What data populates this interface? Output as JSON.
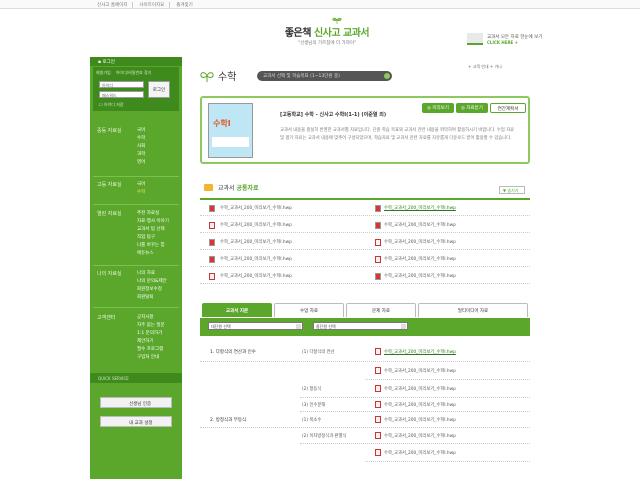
{
  "topbar": {
    "links": [
      "신사고 홈페이지",
      "사이트이지요",
      "즐겨찾기"
    ]
  },
  "logo": {
    "main_left": "좋은책",
    "main_mid": "신사고",
    "main_right": "교과서",
    "slogan": "\"선생님의 가르침에 더 가까이\""
  },
  "promo": {
    "line1": "교과서 모든 자료 한눈에 보기",
    "line2": "CLICK HERE +"
  },
  "login": {
    "header": "로그인",
    "tab1": "회원가입",
    "tab2": "아이디/비밀번호 찾기",
    "id_value": "아이디",
    "pw_value": "패스워드",
    "button": "로그인",
    "save_id": "아이디 저장"
  },
  "nav": [
    {
      "heading": "중등 자료실",
      "items": [
        "국어",
        "수학",
        "사회",
        "과학",
        "영어"
      ],
      "active": -1
    },
    {
      "heading": "고등 자료실",
      "items": [
        "국어",
        "수학"
      ],
      "active": 1
    },
    {
      "heading": "열린 자료실",
      "items": [
        "추천 자료실",
        "자료·행사 이야기",
        "교과서 탐 선택",
        "직업 탐구",
        "나를 바꾸는 힘",
        "에듀뉴스"
      ],
      "active": -1
    },
    {
      "heading": "나의 자료실",
      "items": [
        "나의 자료",
        "나의 문의&제안",
        "회원정보수정",
        "회원탈퇴"
      ],
      "active": -1
    },
    {
      "heading": "고객센터",
      "items": [
        "공지사항",
        "자주 묻는 질문",
        "1:1 문의하기",
        "제안하기",
        "필수 프로그램",
        "구입처 안내"
      ],
      "active": -1
    }
  ],
  "quick_service": {
    "header": "QUICK SERVICE",
    "btn1": "선생님 인증",
    "btn2": "내 교과 설정"
  },
  "subject": {
    "title": "수학",
    "search_value": "교과서 선택 및 학습목표 (1~13단원 중)",
    "tools": "+ 고객 안내 + 가나"
  },
  "book": {
    "cover_title": "수학Ⅰ",
    "title": "[고등학교] 수학 - 신사고 수학Ⅰ(1-1) (이준열 외)",
    "desc": "교과서 내용을 충실히 반영한 교과서별 자료입니다. 단원 학습 목표와 교과서 관련 내용을 파악하여 활용하시기 바랍니다. 수업 자료 및 평가 자료는 교과서 내용에 맞추어 구성되었으며, 학습자료 및 교과서 관련 자료를 자유롭게 다운로드 받아 활용할 수 있습니다.",
    "btn_preview": "미리보기",
    "btn_download": "자료받기",
    "btn_plan": "연간계획서"
  },
  "common": {
    "title_left": "교과서",
    "title_right": "공통자료",
    "hide": "숨기기",
    "rows": [
      [
        "수학_교과서_200_미리보기_수학Ⅰ.hwp",
        "수학_교과서_200_미리보기_수학Ⅰ.hwp"
      ],
      [
        "수학_교과서_200_미리보기_수학Ⅰ.hwp",
        "수학_교과서_200_미리보기_수학Ⅰ.hwp"
      ],
      [
        "수학_교과서_200_미리보기_수학Ⅰ.hwp",
        "수학_교과서_200_미리보기_수학Ⅰ.hwp"
      ],
      [
        "수학_교과서_200_미리보기_수학Ⅰ.hwp",
        "수학_교과서_200_미리보기_수학Ⅰ.hwp"
      ],
      [
        "수학_교과서_200_미리보기_수학Ⅰ.hwp",
        "수학_교과서_200_미리보기_수학Ⅰ.hwp"
      ]
    ]
  },
  "tabs": [
    "교과서 지문",
    "수업 자료",
    "문제 자료",
    "멀티미디어 자료"
  ],
  "filters": {
    "unit": "대단원 선택",
    "sub": "중단원 선택"
  },
  "lessons": [
    {
      "unit": "1. 다항식의 연산과 인수",
      "sub": "(1) 다항식의 연산",
      "file": "수학_교과서_200_미리보기_수학Ⅰ.hwp"
    },
    {
      "unit": "",
      "sub": "",
      "file": "수학_교과서_200_미리보기_수학Ⅰ.hwp"
    },
    {
      "unit": "",
      "sub": "(2) 항등식",
      "file": "수학_교과서_200_미리보기_수학Ⅰ.hwp"
    },
    {
      "unit": "",
      "sub": "(3) 인수분해",
      "file": "수학_교과서_200_미리보기_수학Ⅰ.hwp"
    },
    {
      "unit": "2. 방정식과 부등식",
      "sub": "(1) 복소수",
      "file": "수학_교과서_200_미리보기_수학Ⅰ.hwp"
    },
    {
      "unit": "",
      "sub": "(2) 이차방정식과 판별식",
      "file": "수학_교과서_200_미리보기_수학Ⅰ.hwp"
    },
    {
      "unit": "",
      "sub": "",
      "file": "수학_교과서_200_미리보기_수학Ⅰ.hwp"
    }
  ],
  "colors": {
    "brand_green": "#5aa72b",
    "dark_green": "#3e8a1c",
    "light_green": "#8ec85f"
  }
}
